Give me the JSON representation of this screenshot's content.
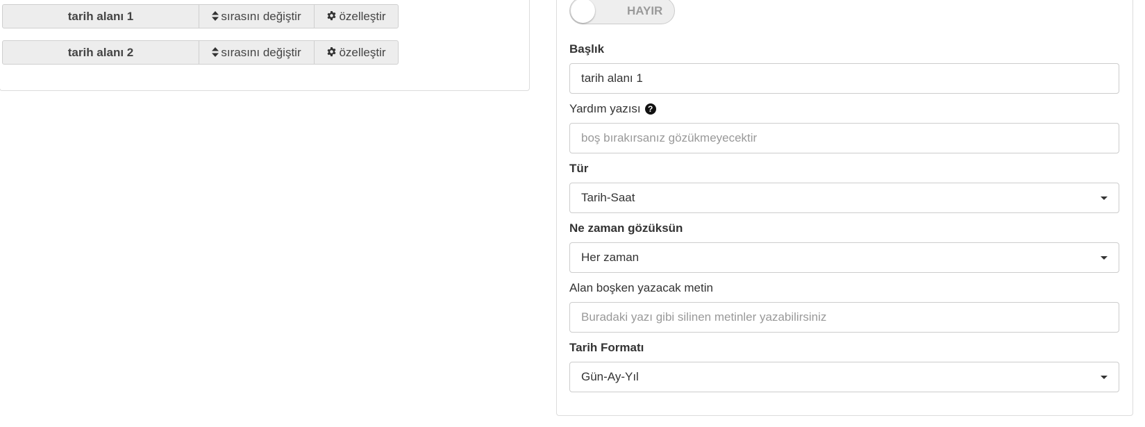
{
  "field_list": {
    "rows": [
      {
        "name": "tarih alanı 1",
        "order_label": "sırasını değiştir",
        "customize_label": "özelleştir"
      },
      {
        "name": "tarih alanı 2",
        "order_label": "sırasını değiştir",
        "customize_label": "özelleştir"
      }
    ],
    "order_icon": "sort-icon",
    "customize_icon": "gear-icon"
  },
  "settings": {
    "toggle": {
      "label": "HAYIR",
      "state": "off"
    },
    "title": {
      "label": "Başlık",
      "value": "tarih alanı 1"
    },
    "help_text": {
      "label": "Yardım yazısı",
      "icon": "question-circle-icon",
      "placeholder": "boş bırakırsanız gözükmeyecektir"
    },
    "type": {
      "label": "Tür",
      "selected": "Tarih-Saat"
    },
    "visibility": {
      "label": "Ne zaman gözüksün",
      "selected": "Her zaman"
    },
    "empty_text": {
      "label": "Alan boşken yazacak metin",
      "placeholder": "Buradaki yazı gibi silinen metinler yazabilirsiniz"
    },
    "date_format": {
      "label": "Tarih Formatı",
      "selected": "Gün-Ay-Yıl"
    }
  }
}
